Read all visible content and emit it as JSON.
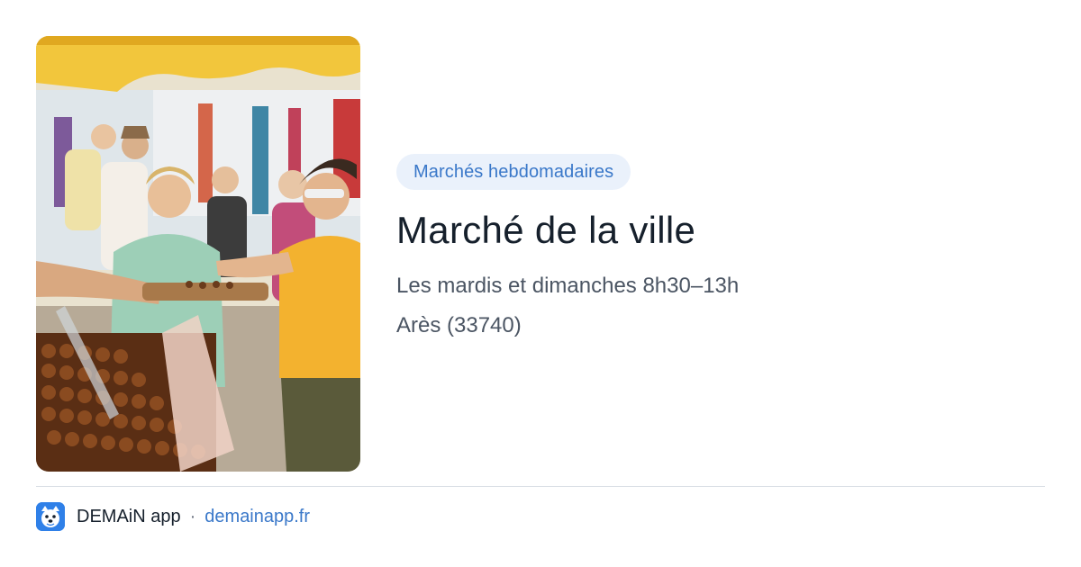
{
  "card": {
    "image_alt": "Photo du marché",
    "category_badge": "Marchés hebdomadaires",
    "title": "Marché de la ville",
    "schedule": "Les mardis et dimanches 8h30–13h",
    "location": "Arès (33740)"
  },
  "footer": {
    "app_name": "DEMAiN app",
    "separator": "·",
    "link_text": "demainapp.fr",
    "logo_icon": "dog-face-icon"
  },
  "colors": {
    "badge_background": "#eaf1fb",
    "accent": "#3a78c9",
    "title": "#16202c",
    "body_text": "#4b5563",
    "divider": "#d9dee5",
    "logo_background": "#2f80e8"
  }
}
